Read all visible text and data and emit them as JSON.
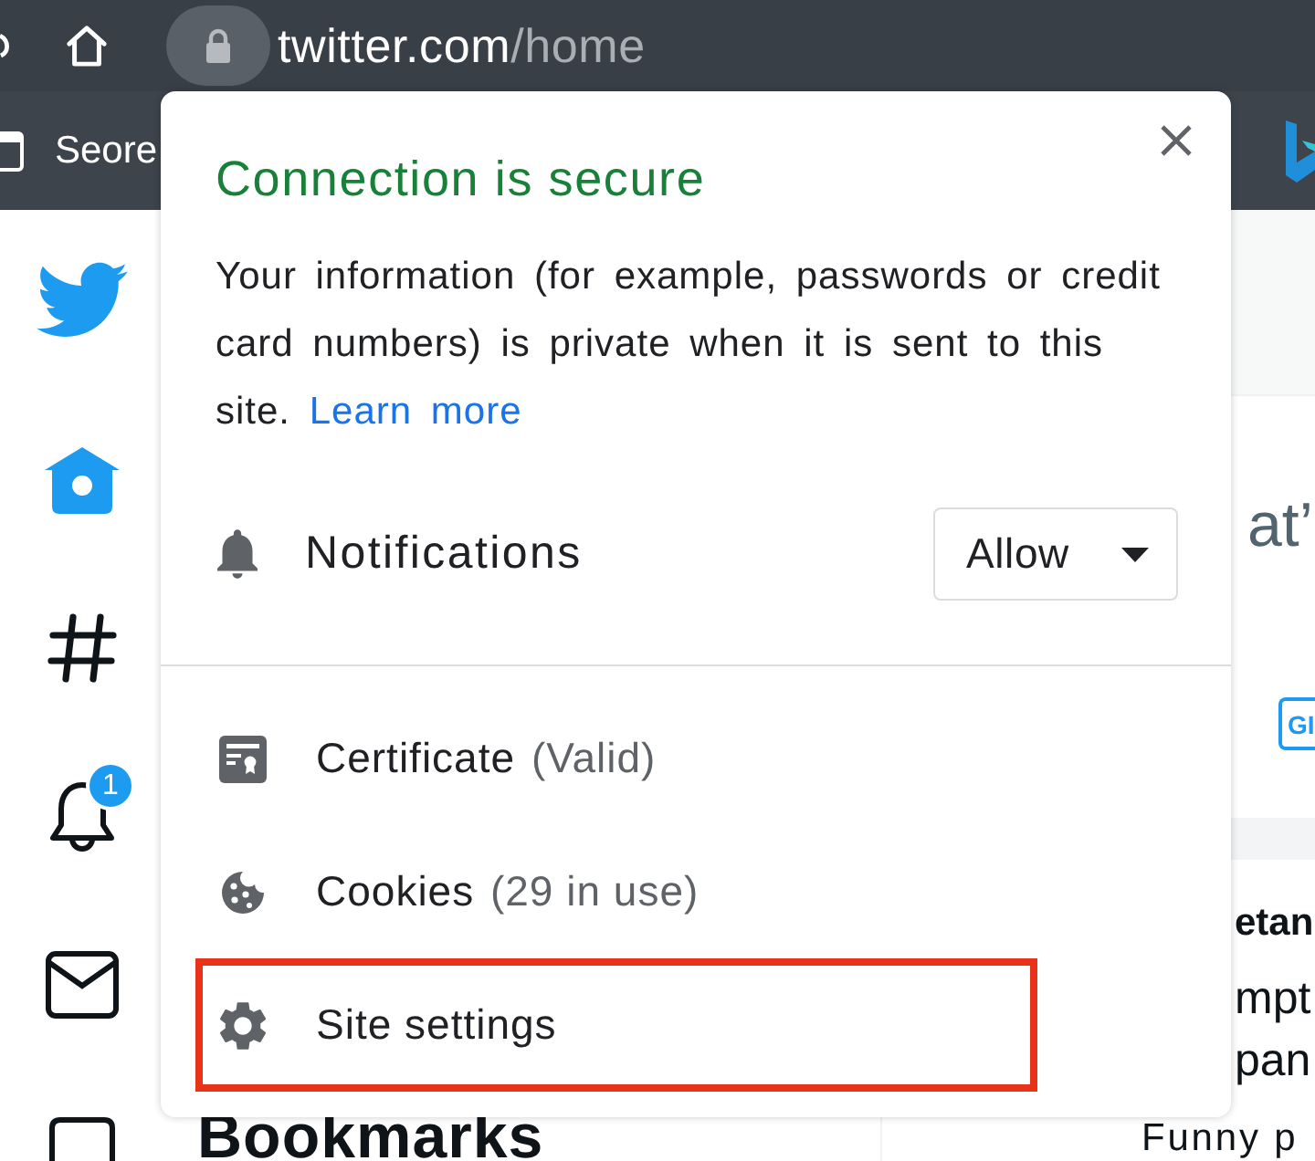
{
  "toolbar": {
    "address": {
      "host": "twitter.com",
      "path": "/home"
    }
  },
  "bookmarks_bar": {
    "items": [
      {
        "label": "Seore"
      }
    ]
  },
  "sidebar": {
    "items": [
      {
        "kind": "home",
        "selected": true
      },
      {
        "kind": "explore",
        "selected": false
      },
      {
        "kind": "notifications",
        "selected": false,
        "badge": "1"
      },
      {
        "kind": "messages",
        "selected": false
      },
      {
        "kind": "bookmarks",
        "selected": false,
        "label": "Bookmarks"
      }
    ]
  },
  "main": {
    "compose": {
      "placeholder": "at’"
    },
    "media_button": "GI",
    "tweet": {
      "author": "etan",
      "lines": [
        "mpt",
        "pan"
      ],
      "last_line": "Funny p"
    }
  },
  "site_info_popup": {
    "title": "Connection is secure",
    "description": "Your information (for example, passwords or credit card numbers) is private when it is sent to this site.",
    "learn_more": "Learn more",
    "permissions": [
      {
        "kind": "notifications",
        "label": "Notifications",
        "value": "Allow"
      }
    ],
    "items": [
      {
        "kind": "certificate",
        "label": "Certificate",
        "detail": "(Valid)",
        "highlighted": false
      },
      {
        "kind": "cookies",
        "label": "Cookies",
        "detail": "(29 in use)",
        "highlighted": false
      },
      {
        "kind": "site_settings",
        "label": "Site settings",
        "highlighted": true
      }
    ]
  }
}
